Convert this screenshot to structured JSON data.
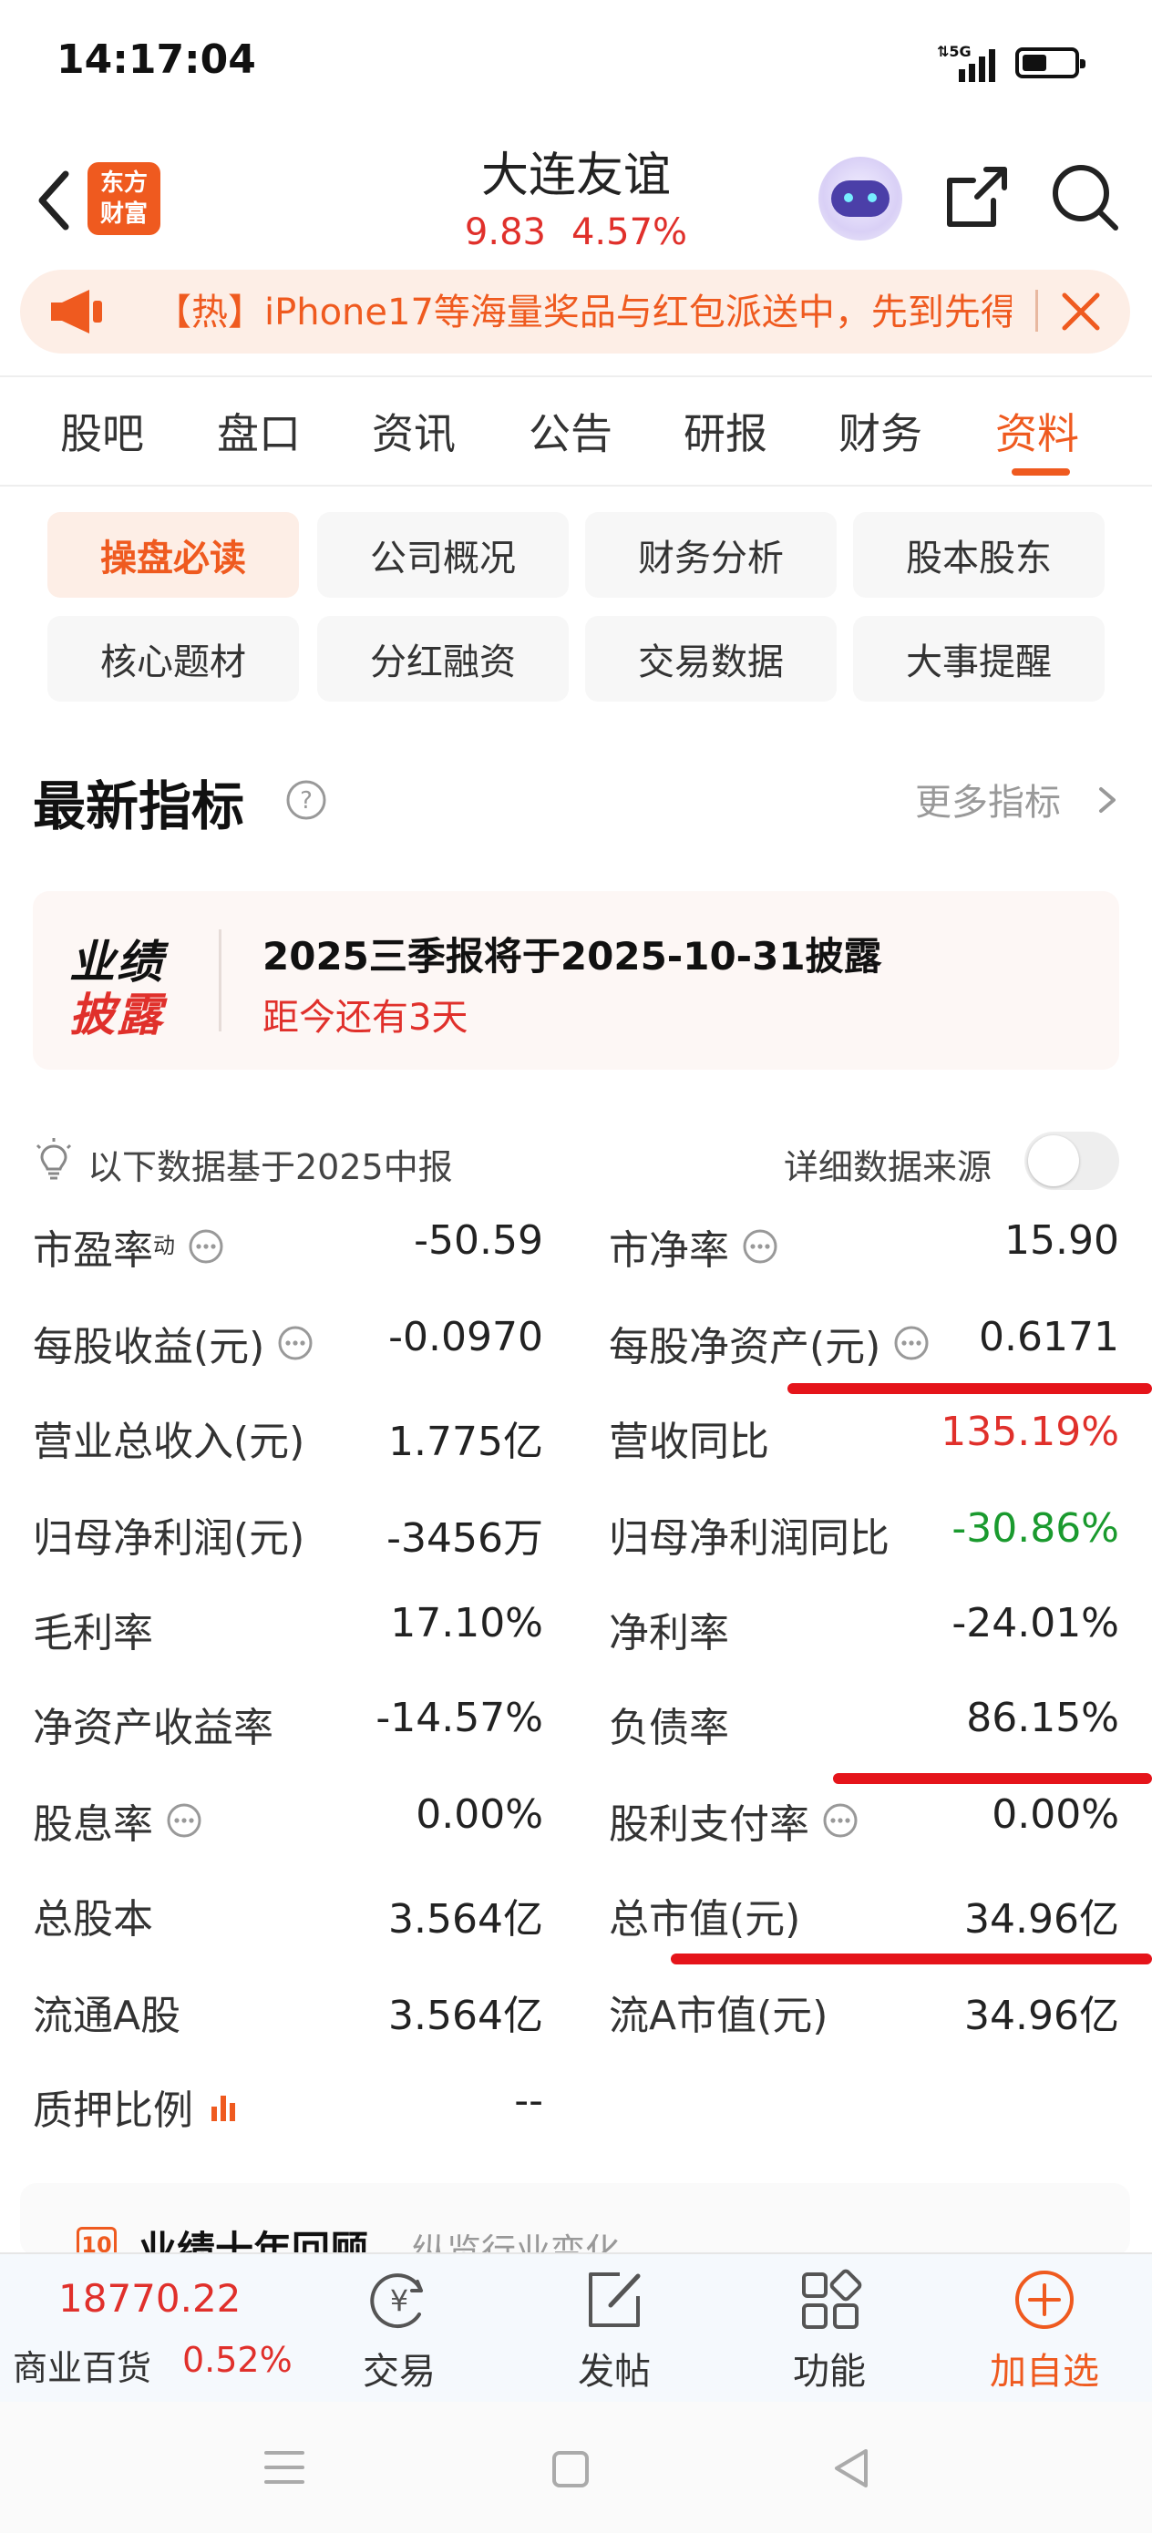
{
  "status_bar": {
    "time": "14:17:04",
    "network": "5G"
  },
  "header": {
    "brand_line1": "东方",
    "brand_line2": "财富",
    "title": "大连友谊",
    "price": "9.83",
    "change_pct": "4.57%"
  },
  "banner": {
    "text": "【热】iPhone17等海量奖品与红包派送中，先到先得"
  },
  "tabs": [
    {
      "label": "股吧"
    },
    {
      "label": "盘口"
    },
    {
      "label": "资讯"
    },
    {
      "label": "公告"
    },
    {
      "label": "研报"
    },
    {
      "label": "财务"
    },
    {
      "label": "资料"
    }
  ],
  "active_tab": "资料",
  "subnav": [
    {
      "label": "操盘必读"
    },
    {
      "label": "公司概况"
    },
    {
      "label": "财务分析"
    },
    {
      "label": "股本股东"
    },
    {
      "label": "核心题材"
    },
    {
      "label": "分红融资"
    },
    {
      "label": "交易数据"
    },
    {
      "label": "大事提醒"
    }
  ],
  "section": {
    "title": "最新指标",
    "more": "更多指标"
  },
  "disclosure": {
    "badge_line1": "业绩",
    "badge_line2": "披露",
    "title": "2025三季报将于2025-10-31披露",
    "subtitle": "距今还有3天"
  },
  "basis": {
    "text": "以下数据基于2025中报",
    "source_label": "详细数据来源",
    "source_toggle": false
  },
  "metrics_left": [
    {
      "label": "市盈率",
      "sup": "动",
      "value": "-50.59"
    },
    {
      "label": "每股收益(元)",
      "value": "-0.0970"
    },
    {
      "label": "营业总收入(元)",
      "value": "1.775亿"
    },
    {
      "label": "归母净利润(元)",
      "value": "-3456万"
    },
    {
      "label": "毛利率",
      "value": "17.10%"
    },
    {
      "label": "净资产收益率",
      "value": "-14.57%"
    },
    {
      "label": "股息率",
      "value": "0.00%"
    },
    {
      "label": "总股本",
      "value": "3.564亿"
    },
    {
      "label": "流通A股",
      "value": "3.564亿"
    },
    {
      "label": "质押比例",
      "value": "--"
    }
  ],
  "metrics_right": [
    {
      "label": "市净率",
      "value": "15.90"
    },
    {
      "label": "每股净资产(元)",
      "value": "0.6171"
    },
    {
      "label": "营收同比",
      "value": "135.19%"
    },
    {
      "label": "归母净利润同比",
      "value": "-30.86%"
    },
    {
      "label": "净利率",
      "value": "-24.01%"
    },
    {
      "label": "负债率",
      "value": "86.15%"
    },
    {
      "label": "股利支付率",
      "value": "0.00%"
    },
    {
      "label": "总市值(元)",
      "value": "34.96亿"
    },
    {
      "label": "流A市值(元)",
      "value": "34.96亿"
    }
  ],
  "next_card": {
    "badge": "10",
    "title": "业绩十年回顾",
    "subtitle": "纵览行业变化"
  },
  "bottom_bar": {
    "index_value": "18770.22",
    "index_name": "商业百货",
    "index_pct": "0.52%",
    "items": [
      {
        "label": "交易",
        "icon": "yen-circle-icon"
      },
      {
        "label": "发帖",
        "icon": "edit-icon"
      },
      {
        "label": "功能",
        "icon": "grid-icon"
      },
      {
        "label": "加自选",
        "icon": "add-circle-icon"
      }
    ]
  },
  "colors": {
    "brand_orange": "#ef5a1f",
    "up_red": "#e0302b",
    "down_green": "#1a9a2e",
    "annotation_red": "#e5141a"
  }
}
